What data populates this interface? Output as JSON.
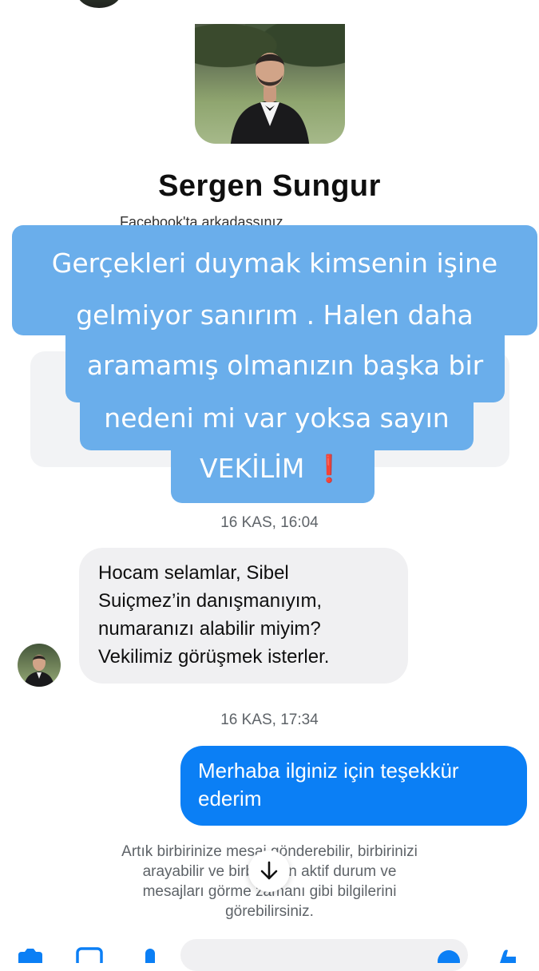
{
  "profile": {
    "name": "Sergen Sungur",
    "subtitle_partial": "Facebook'ta arkadaşsınız"
  },
  "overlay": {
    "lines": [
      "Gerçekleri duymak kimsenin işine",
      "gelmiyor sanırım . Halen daha",
      "aramamış olmanızın başka bir",
      "nedeni mi var yoksa sayın",
      "VEKİLİM ❗"
    ],
    "background_color": "#6aaeeb"
  },
  "messages": {
    "timestamp_1": "16 KAS, 16:04",
    "incoming_lines": [
      "Hocam selamlar, Sibel",
      "Suiçmez’in danışmanıyım,",
      "numaranızı alabilir miyim?",
      "Vekilimiz görüşmek isterler."
    ],
    "timestamp_2": "16 KAS, 17:34",
    "outgoing_lines": [
      "Merhaba ilginiz için teşekkür",
      "ederim"
    ],
    "outgoing_color": "#0b7ff5"
  },
  "notice": {
    "lines": [
      "Artık birbirinize mesaj gönderebilir, birbirinizi",
      "arayabilir ve birbirinizin aktif durum ve",
      "mesajları görme zamanı gibi bilgilerini",
      "görebilirsiniz."
    ]
  },
  "icons": {
    "scroll": "arrow-down-icon",
    "composer": [
      "camera-icon",
      "image-icon",
      "microphone-icon",
      "emoji-icon",
      "like-icon"
    ]
  },
  "accent_color": "#0b7ff5"
}
